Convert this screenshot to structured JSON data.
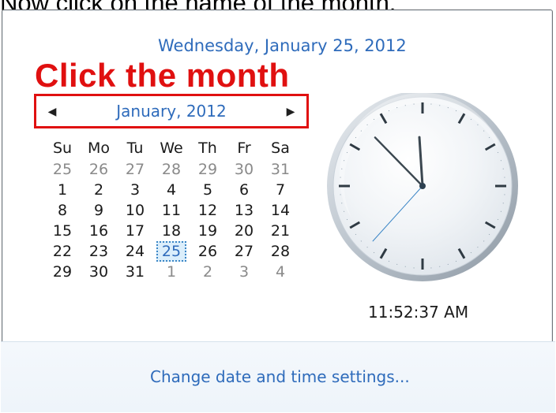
{
  "caption": "Now click on the name of the month,",
  "header": {
    "long_date": "Wednesday, January 25, 2012"
  },
  "instruction": "Click the month",
  "calendar": {
    "month_title": "January, 2012",
    "prev_icon": "left-triangle",
    "next_icon": "right-triangle",
    "weekdays": [
      "Su",
      "Mo",
      "Tu",
      "We",
      "Th",
      "Fr",
      "Sa"
    ],
    "weeks": [
      [
        "25",
        "26",
        "27",
        "28",
        "29",
        "30",
        "31"
      ],
      [
        "1",
        "2",
        "3",
        "4",
        "5",
        "6",
        "7"
      ],
      [
        "8",
        "9",
        "10",
        "11",
        "12",
        "13",
        "14"
      ],
      [
        "15",
        "16",
        "17",
        "18",
        "19",
        "20",
        "21"
      ],
      [
        "22",
        "23",
        "24",
        "25",
        "26",
        "27",
        "28"
      ],
      [
        "29",
        "30",
        "31",
        "1",
        "2",
        "3",
        "4"
      ]
    ],
    "selected_day": "25"
  },
  "clock": {
    "time_text": "11:52:37 AM",
    "hours": 11,
    "minutes": 52,
    "seconds": 37
  },
  "footer": {
    "link_label": "Change date and time settings..."
  },
  "colors": {
    "accent_blue": "#2e6bbb",
    "highlight_red": "#e01010"
  }
}
